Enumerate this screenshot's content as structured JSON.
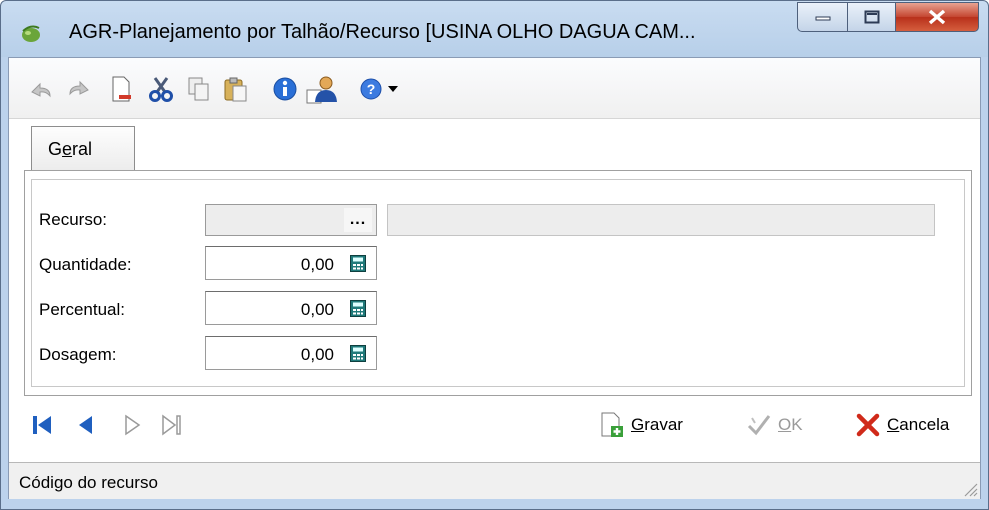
{
  "window": {
    "title": "AGR-Planejamento por Talhão/Recurso [USINA OLHO  DAGUA CAM...",
    "minimize_label": "_",
    "maximize_label": "□",
    "close_label": "X"
  },
  "toolbar": {
    "icons": [
      "undo-icon",
      "redo-icon",
      "delete-document-icon",
      "cut-icon",
      "copy-icon",
      "paste-icon",
      "info-icon",
      "user-icon",
      "help-icon",
      "dropdown-arrow-icon"
    ]
  },
  "tabs": [
    {
      "label": "Geral",
      "accel": "e"
    }
  ],
  "form": {
    "recurso": {
      "label": "Recurso:",
      "value": "",
      "description": "",
      "ellipsis": "..."
    },
    "quantidade": {
      "label": "Quantidade:",
      "value": "0,00"
    },
    "percentual": {
      "label": "Percentual:",
      "value": "0,00"
    },
    "dosagem": {
      "label": "Dosagem:",
      "value": "0,00"
    }
  },
  "navigation": {
    "first": "first-record-icon",
    "prev": "previous-record-icon",
    "next": "next-record-icon",
    "last": "last-record-icon"
  },
  "actions": {
    "gravar": "Gravar",
    "ok": "OK",
    "cancela": "Cancela"
  },
  "status": {
    "text": "Código do recurso"
  },
  "colors": {
    "accent_blue": "#1f5fbf",
    "cancel_red": "#d02a1a",
    "disabled_gray": "#9a9a9a"
  }
}
